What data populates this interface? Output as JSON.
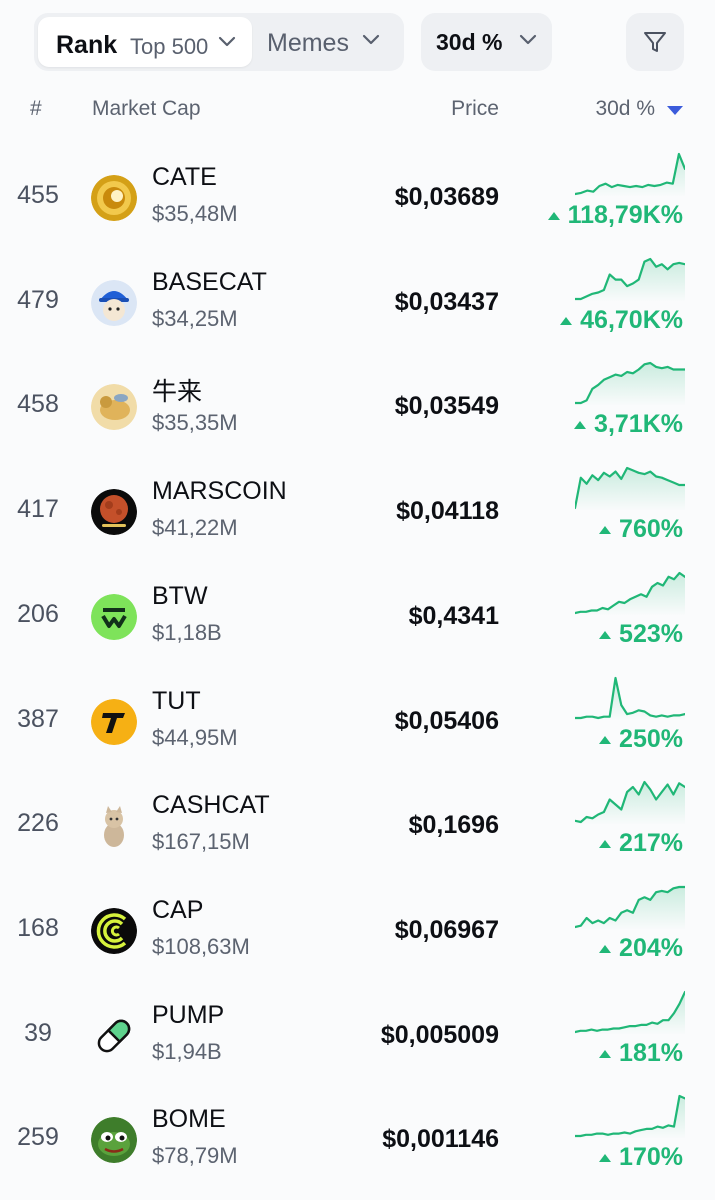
{
  "filters": {
    "rank_label": "Rank",
    "rank_value": "Top 500",
    "category": "Memes",
    "period": "30d %"
  },
  "columns": {
    "number": "#",
    "market_cap": "Market Cap",
    "price": "Price",
    "change": "30d %",
    "sort_icon": "sort-descending-triangle"
  },
  "colors": {
    "positive": "#20b777",
    "sort_indicator": "#3b5bdb",
    "chip_background": "#eef0f3"
  },
  "coins": [
    {
      "rank": "455",
      "name": "CATE",
      "market_cap": "$35,48M",
      "price": "$0,03689",
      "change": "118,79K%",
      "icon": "cate-logo-icon",
      "spark": [
        3,
        4,
        6,
        5,
        10,
        12,
        9,
        11,
        10,
        9,
        10,
        9,
        11,
        10,
        11,
        13,
        12,
        38,
        25
      ]
    },
    {
      "rank": "479",
      "name": "BASECAT",
      "market_cap": "$34,25M",
      "price": "$0,03437",
      "change": "46,70K%",
      "icon": "basecat-logo-icon",
      "spark": [
        3,
        3,
        5,
        7,
        8,
        10,
        22,
        18,
        18,
        13,
        15,
        18,
        32,
        34,
        28,
        30,
        26,
        30,
        31,
        30
      ]
    },
    {
      "rank": "458",
      "name": "牛来",
      "market_cap": "$35,35M",
      "price": "$0,03549",
      "change": "3,71K%",
      "icon": "niulai-logo-icon",
      "spark": [
        4,
        4,
        6,
        15,
        18,
        22,
        24,
        26,
        25,
        28,
        27,
        30,
        34,
        35,
        32,
        31,
        32,
        30,
        30,
        30
      ]
    },
    {
      "rank": "417",
      "name": "MARSCOIN",
      "market_cap": "$41,22M",
      "price": "$0,04118",
      "change": "760%",
      "icon": "marscoin-logo-icon",
      "spark": [
        5,
        30,
        25,
        32,
        28,
        34,
        31,
        35,
        29,
        38,
        36,
        34,
        33,
        35,
        31,
        30,
        28,
        26,
        24,
        24
      ]
    },
    {
      "rank": "206",
      "name": "BTW",
      "market_cap": "$1,18B",
      "price": "$0,4341",
      "change": "523%",
      "icon": "btw-logo-icon",
      "spark": [
        3,
        4,
        4,
        5,
        5,
        7,
        6,
        9,
        12,
        11,
        14,
        16,
        18,
        16,
        24,
        27,
        25,
        32,
        30,
        35,
        32
      ]
    },
    {
      "rank": "387",
      "name": "TUT",
      "market_cap": "$44,95M",
      "price": "$0,05406",
      "change": "250%",
      "icon": "tut-logo-icon",
      "spark": [
        4,
        4,
        5,
        5,
        4,
        5,
        5,
        35,
        14,
        7,
        8,
        10,
        9,
        6,
        5,
        6,
        5,
        6,
        6,
        7
      ]
    },
    {
      "rank": "226",
      "name": "CASHCAT",
      "market_cap": "$167,15M",
      "price": "$0,1696",
      "change": "217%",
      "icon": "cashcat-logo-icon",
      "spark": [
        5,
        4,
        8,
        7,
        10,
        12,
        22,
        18,
        14,
        28,
        32,
        26,
        36,
        30,
        22,
        28,
        34,
        26,
        35,
        32
      ]
    },
    {
      "rank": "168",
      "name": "CAP",
      "market_cap": "$108,63M",
      "price": "$0,06967",
      "change": "204%",
      "icon": "cap-logo-icon",
      "spark": [
        3,
        4,
        10,
        6,
        8,
        6,
        10,
        8,
        14,
        16,
        14,
        24,
        26,
        24,
        30,
        31,
        30,
        33,
        34,
        34
      ]
    },
    {
      "rank": "39",
      "name": "PUMP",
      "market_cap": "$1,94B",
      "price": "$0,005009",
      "change": "181%",
      "icon": "pump-logo-icon",
      "spark": [
        4,
        5,
        5,
        6,
        5,
        6,
        6,
        7,
        7,
        8,
        9,
        9,
        10,
        10,
        12,
        11,
        14,
        14,
        20,
        28,
        38
      ]
    },
    {
      "rank": "259",
      "name": "BOME",
      "market_cap": "$78,79M",
      "price": "$0,001146",
      "change": "170%",
      "icon": "bome-logo-icon",
      "spark": [
        4,
        4,
        5,
        5,
        6,
        6,
        5,
        6,
        6,
        7,
        6,
        8,
        9,
        10,
        10,
        12,
        11,
        13,
        12,
        38,
        36
      ]
    }
  ]
}
